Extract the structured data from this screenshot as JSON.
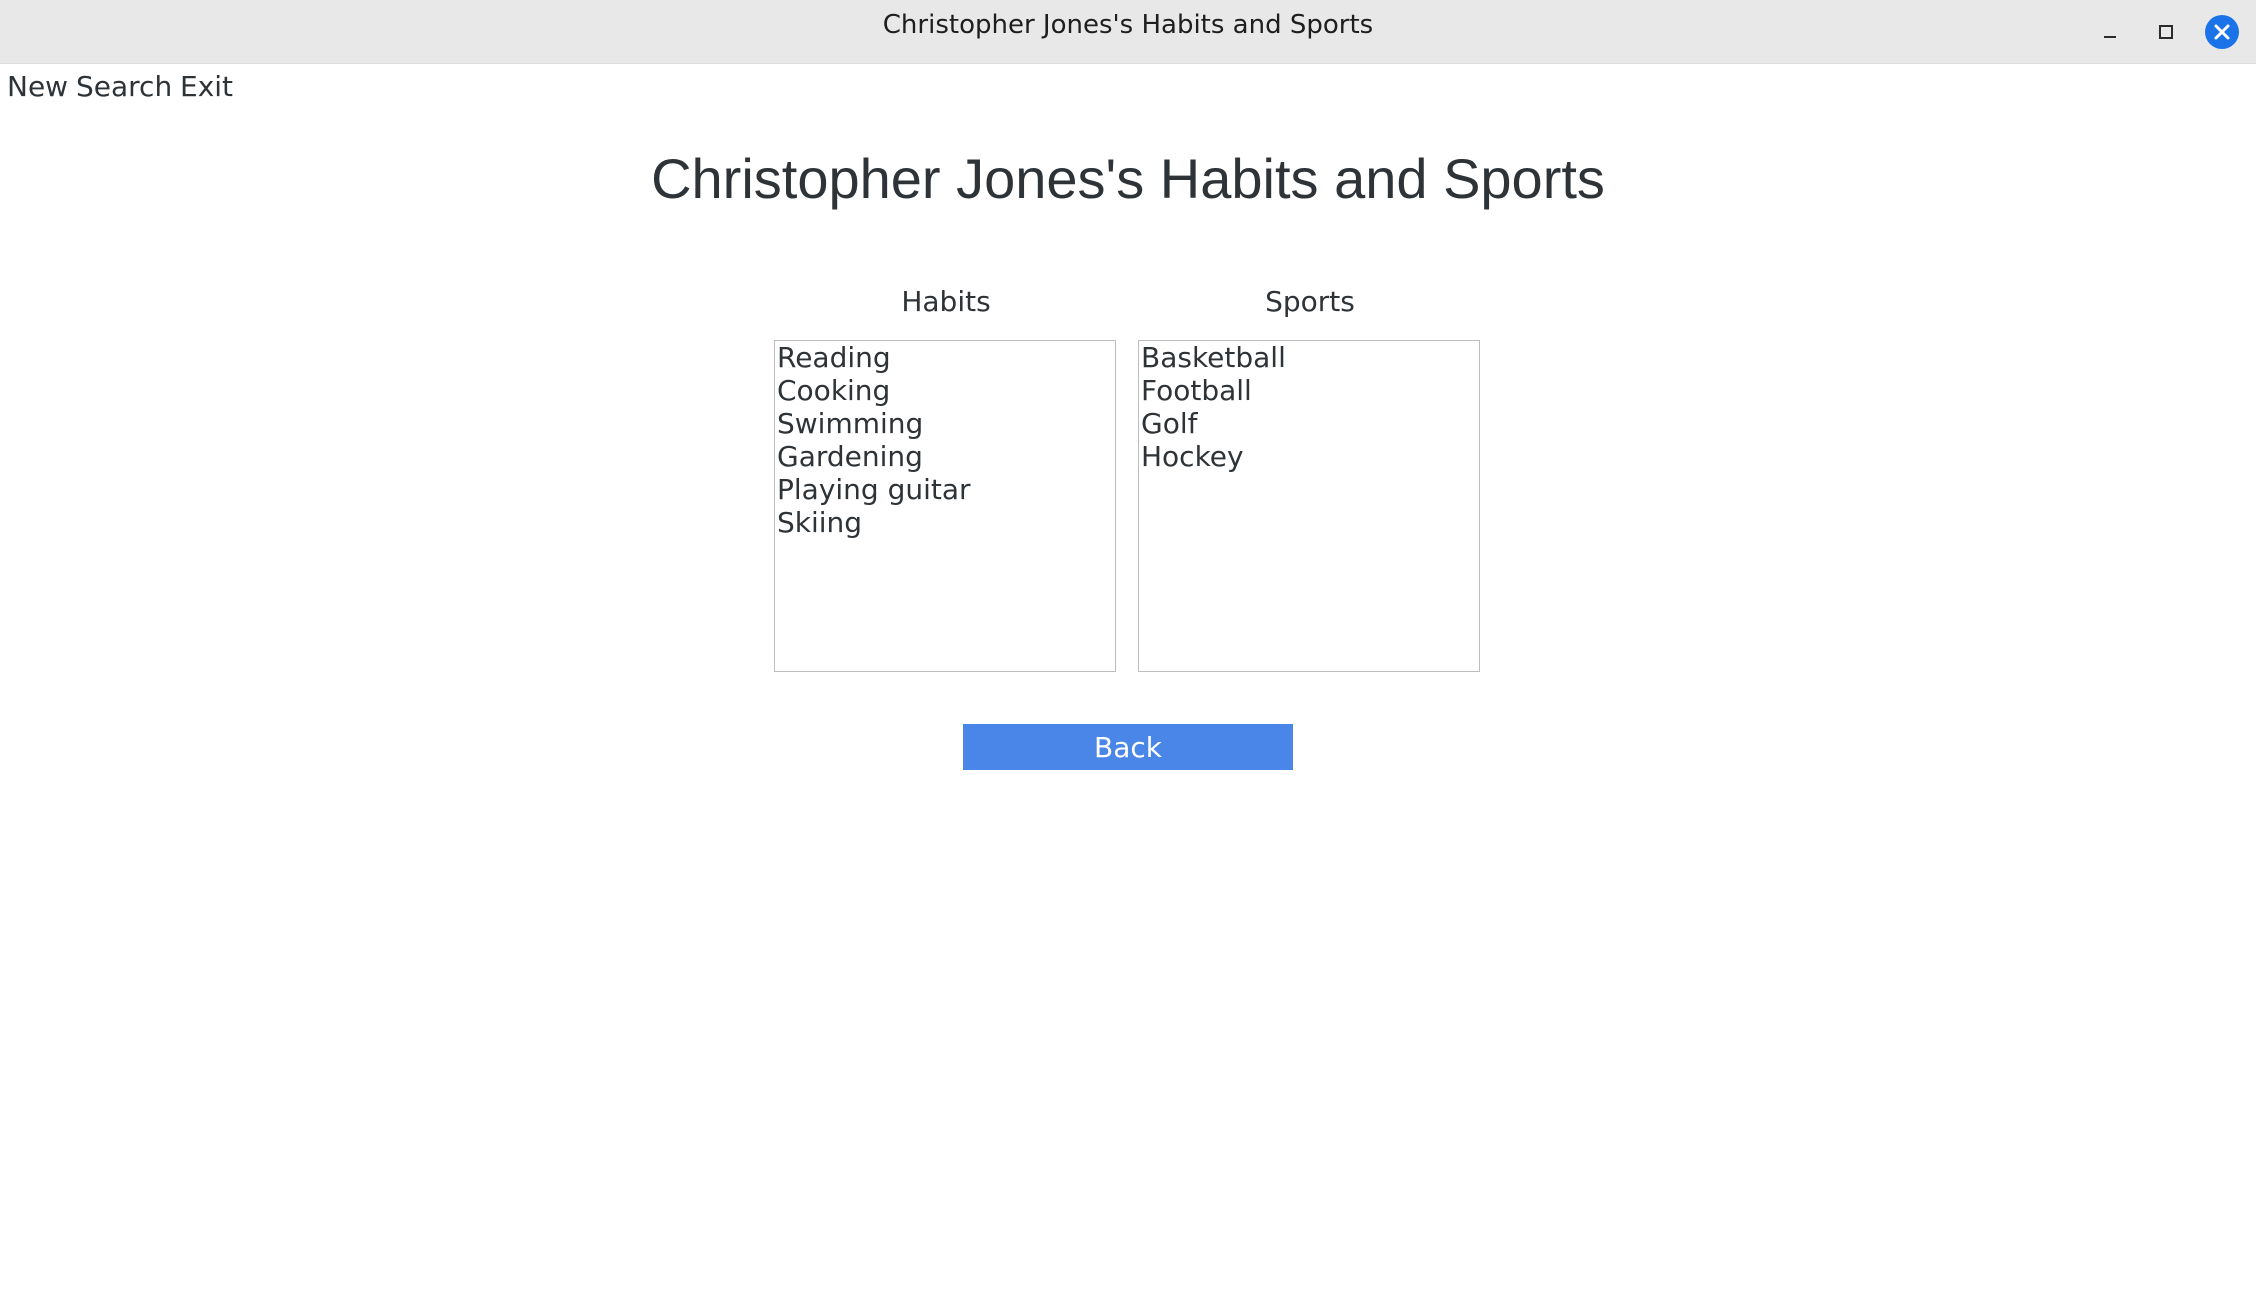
{
  "window": {
    "title": "Christopher Jones's Habits and Sports",
    "accent_color": "#1a73e8"
  },
  "menu": {
    "items": [
      "New",
      "Search",
      "Exit"
    ]
  },
  "main": {
    "heading": "Christopher Jones's Habits and Sports",
    "habits": {
      "label": "Habits",
      "items": [
        "Reading",
        "Cooking",
        "Swimming",
        "Gardening",
        "Playing guitar",
        "Skiing"
      ]
    },
    "sports": {
      "label": "Sports",
      "items": [
        "Basketball",
        "Football",
        "Golf",
        "Hockey"
      ]
    },
    "back_button": {
      "label": "Back",
      "color": "#4a86e8"
    }
  }
}
